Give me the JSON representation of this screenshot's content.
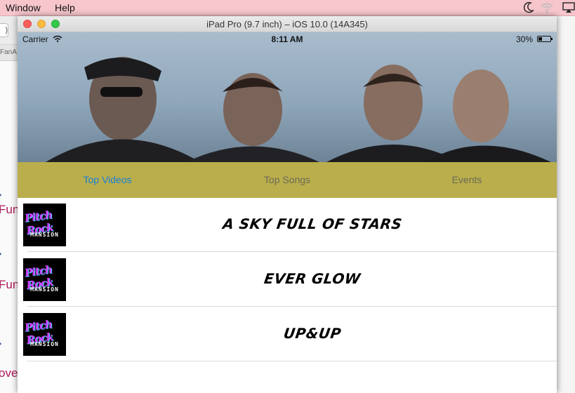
{
  "menubar": {
    "items": [
      "Window",
      "Help"
    ]
  },
  "background_editor": {
    "toolbar_button": ")",
    "tab_label": "FanA",
    "code_fragments": [
      "Fun",
      "Fun",
      "ove"
    ]
  },
  "simulator": {
    "title": "iPad Pro (9.7 inch) – iOS 10.0 (14A345)"
  },
  "status_bar": {
    "carrier": "Carrier",
    "time": "8:11 AM",
    "battery_percent": "30%",
    "battery_level": 0.3
  },
  "tabs": [
    {
      "label": "Top Videos",
      "active": true
    },
    {
      "label": "Top Songs",
      "active": false
    },
    {
      "label": "Events",
      "active": false
    }
  ],
  "songs": [
    {
      "title": "A SKY FULL OF STARS",
      "thumb_top": "Pitch Rock",
      "thumb_bottom": "MANSION"
    },
    {
      "title": "EVER GLOW",
      "thumb_top": "Pitch Rock",
      "thumb_bottom": "MANSION"
    },
    {
      "title": "UP&UP",
      "thumb_top": "Pitch Rock",
      "thumb_bottom": "MANSION"
    }
  ],
  "colors": {
    "menubar": "#f6c6cc",
    "tabbar": "#b9ae4b",
    "active_tab": "#1a7fd8",
    "inactive_tab": "#6d6a58",
    "code_text": "#b0195c"
  }
}
